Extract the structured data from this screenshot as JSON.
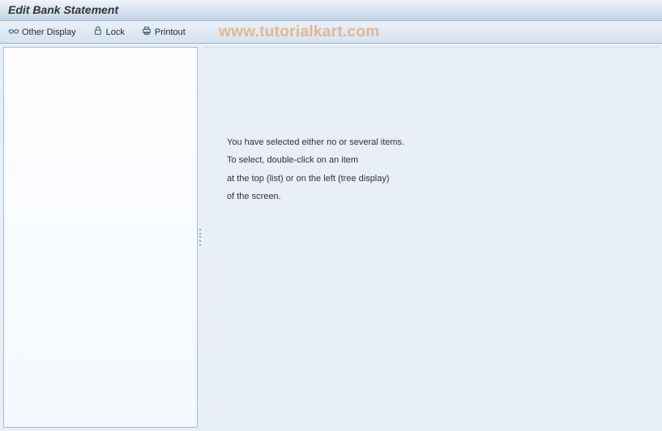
{
  "title": "Edit Bank Statement",
  "toolbar": {
    "other_display": "Other Display",
    "lock": "Lock",
    "printout": "Printout"
  },
  "watermark": "www.tutorialkart.com",
  "message": {
    "line1": "You have selected either no or several items.",
    "line2": "To select, double-click on an item",
    "line3": "at the top (list) or on the left (tree display)",
    "line4": "of the screen."
  }
}
